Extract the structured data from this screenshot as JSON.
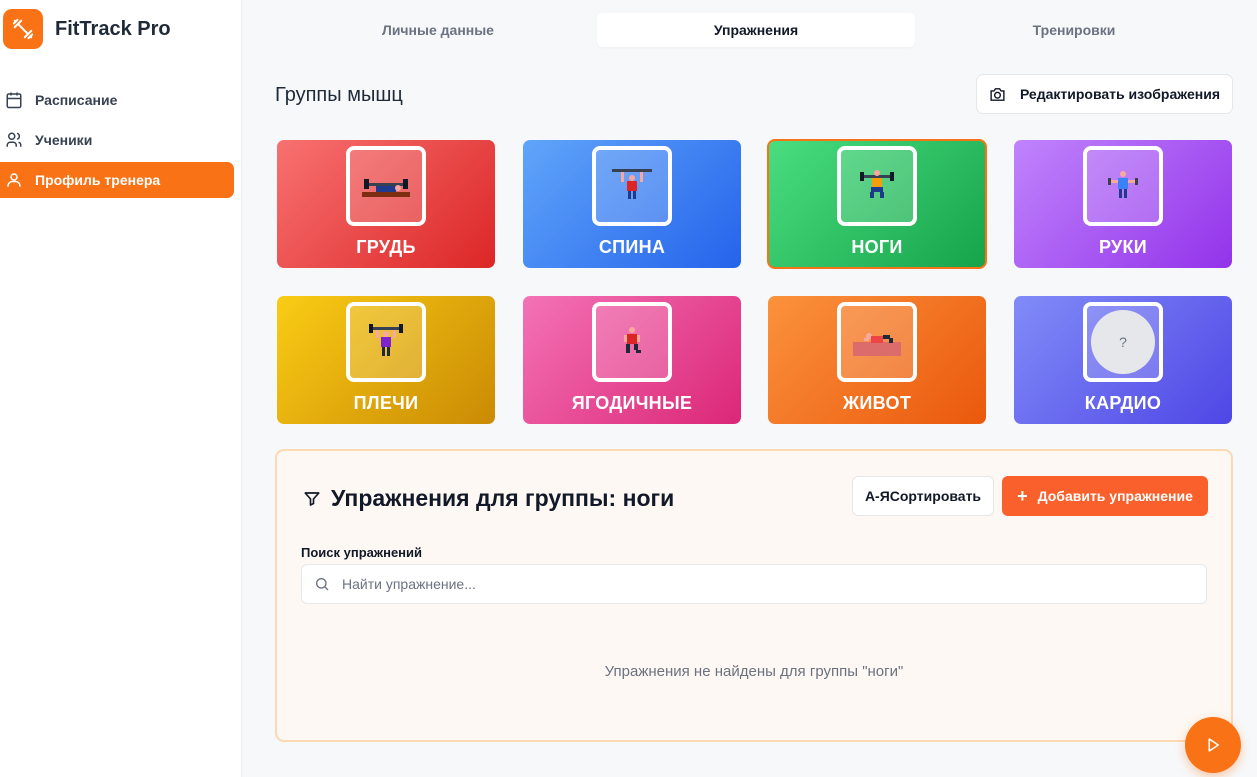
{
  "app": {
    "name": "FitTrack Pro",
    "accent": "#f97316"
  },
  "sidebar": {
    "items": [
      {
        "label": "Расписание",
        "icon": "calendar-icon",
        "active": false
      },
      {
        "label": "Ученики",
        "icon": "users-icon",
        "active": false
      },
      {
        "label": "Профиль тренера",
        "icon": "user-icon",
        "active": true
      }
    ]
  },
  "tabs": [
    {
      "label": "Личные данные",
      "active": false
    },
    {
      "label": "Упражнения",
      "active": true
    },
    {
      "label": "Тренировки",
      "active": false
    }
  ],
  "muscle_groups": {
    "title": "Группы мышц",
    "edit_button": "Редактировать изображения",
    "cards": [
      {
        "label": "ГРУДЬ",
        "icon": "bench-press-icon",
        "color_from": "#f87171",
        "color_to": "#dc2626",
        "selected": false
      },
      {
        "label": "СПИНА",
        "icon": "pull-up-icon",
        "color_from": "#60a5fa",
        "color_to": "#2563eb",
        "selected": false
      },
      {
        "label": "НОГИ",
        "icon": "squat-icon",
        "color_from": "#4ade80",
        "color_to": "#16a34a",
        "selected": true
      },
      {
        "label": "РУКИ",
        "icon": "biceps-curl-icon",
        "color_from": "#c084fc",
        "color_to": "#9333ea",
        "selected": false
      },
      {
        "label": "ПЛЕЧИ",
        "icon": "overhead-press-icon",
        "color_from": "#facc15",
        "color_to": "#ca8a04",
        "selected": false
      },
      {
        "label": "ЯГОДИЧНЫЕ",
        "icon": "lunge-icon",
        "color_from": "#f472b6",
        "color_to": "#db2777",
        "selected": false
      },
      {
        "label": "ЖИВОТ",
        "icon": "crunch-icon",
        "color_from": "#fb923c",
        "color_to": "#ea580c",
        "selected": false
      },
      {
        "label": "КАРДИО",
        "icon": "placeholder-icon",
        "color_from": "#818cf8",
        "color_to": "#4f46e5",
        "selected": false,
        "placeholder": "?"
      }
    ]
  },
  "exercises": {
    "title": "Упражнения для группы: ноги",
    "sort_button": "А-ЯСортировать",
    "add_button": "Добавить упражнение",
    "search_label": "Поиск упражнений",
    "search_placeholder": "Найти упражнение...",
    "search_value": "",
    "empty_message": "Упражнения не найдены для группы \"ноги\""
  }
}
